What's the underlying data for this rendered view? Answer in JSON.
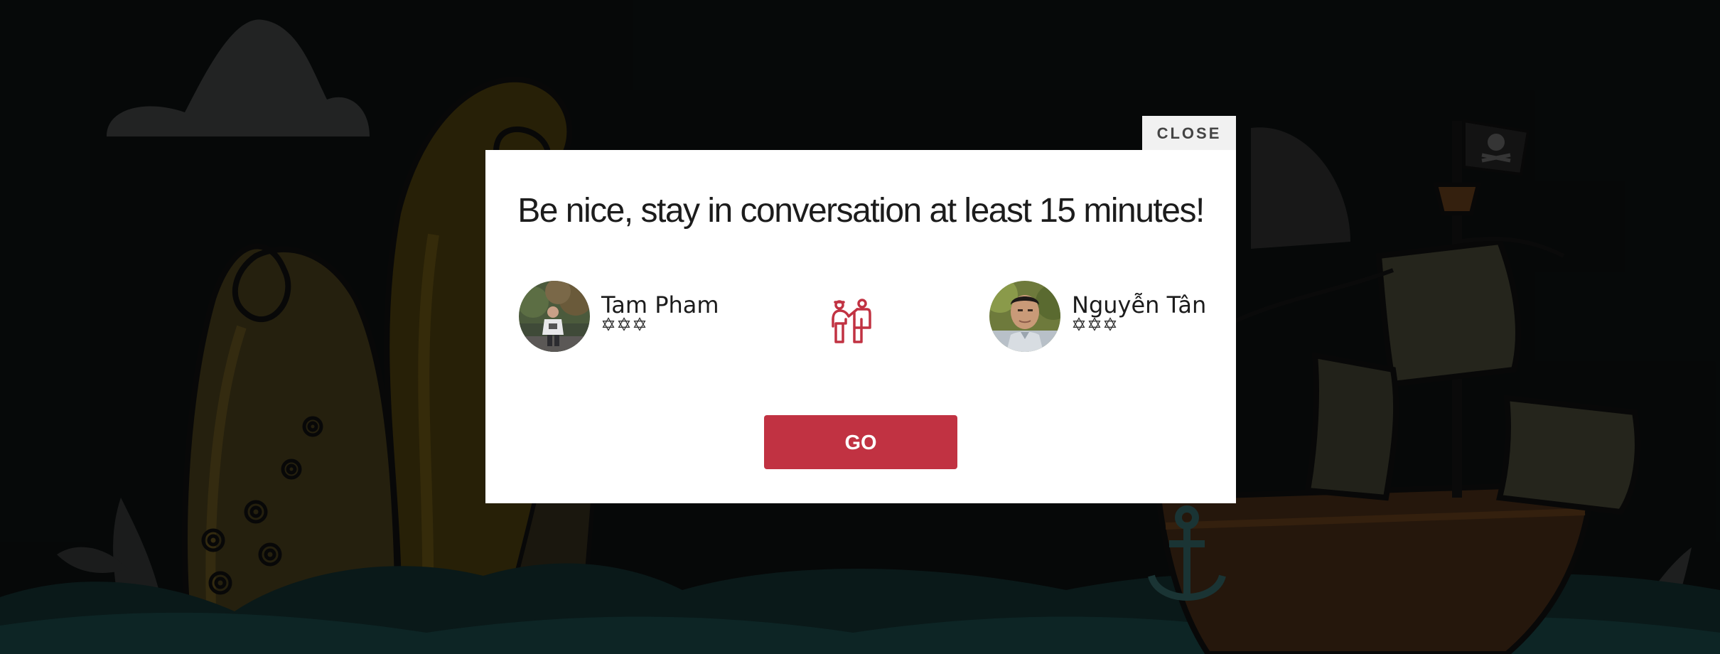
{
  "modal": {
    "close_label": "CLOSE",
    "title": "Be nice, stay in conversation at least 15 minutes!",
    "go_label": "GO",
    "pair_icon": "two-people-icon"
  },
  "participants": [
    {
      "name": "Tam Pham",
      "stars": 3,
      "star_icon": "star-of-david-outline-icon"
    },
    {
      "name": "Nguyễn Tân",
      "stars": 3,
      "star_icon": "star-of-david-outline-icon"
    }
  ],
  "colors": {
    "accent": "#c13242",
    "close_bg": "#f1f1f1",
    "modal_bg": "#ffffff",
    "backdrop": "#070a0a"
  }
}
